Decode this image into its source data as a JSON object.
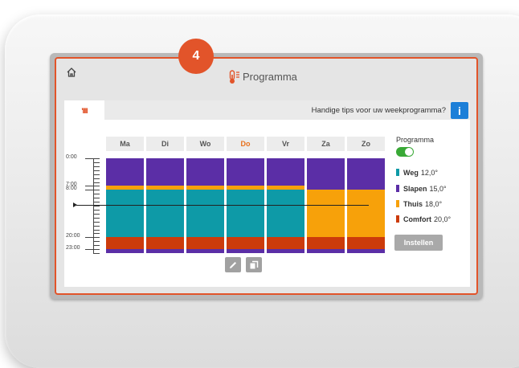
{
  "step_badge": "4",
  "header": {
    "title": "Programma"
  },
  "tabs": {
    "active_tab_label": "'IIII"
  },
  "tips": {
    "text": "Handige tips voor uw weekprogramma?",
    "info_label": "i"
  },
  "days": [
    {
      "label": "Ma",
      "today": false
    },
    {
      "label": "Di",
      "today": false
    },
    {
      "label": "Wo",
      "today": false
    },
    {
      "label": "Do",
      "today": true
    },
    {
      "label": "Vr",
      "today": false
    },
    {
      "label": "Za",
      "today": false
    },
    {
      "label": "Zo",
      "today": false
    }
  ],
  "time_labels": [
    "0:00",
    "7:00",
    "8:00",
    "20:00",
    "23:00"
  ],
  "schedule": {
    "weekday": [
      {
        "mode": "slapen",
        "from": 0,
        "to": 7
      },
      {
        "mode": "thuis",
        "from": 7,
        "to": 8
      },
      {
        "mode": "weg",
        "from": 8,
        "to": 20
      },
      {
        "mode": "comfort",
        "from": 20,
        "to": 23
      },
      {
        "mode": "slapen",
        "from": 23,
        "to": 24
      }
    ],
    "weekend": [
      {
        "mode": "slapen",
        "from": 0,
        "to": 8
      },
      {
        "mode": "thuis",
        "from": 8,
        "to": 20
      },
      {
        "mode": "comfort",
        "from": 20,
        "to": 23
      },
      {
        "mode": "slapen",
        "from": 23,
        "to": 24
      }
    ]
  },
  "programma": {
    "label": "Programma",
    "enabled": true
  },
  "legend": [
    {
      "key": "weg",
      "name": "Weg",
      "temp": "12,0°",
      "color": "#0e9aa7"
    },
    {
      "key": "slapen",
      "name": "Slapen",
      "temp": "15,0°",
      "color": "#5b2ea6"
    },
    {
      "key": "thuis",
      "name": "Thuis",
      "temp": "18,0°",
      "color": "#f7a10a"
    },
    {
      "key": "comfort",
      "name": "Comfort",
      "temp": "20,0°",
      "color": "#cc3b0b"
    }
  ],
  "buttons": {
    "instellen": "Instellen"
  },
  "colors": {
    "accent": "#e2542a",
    "info": "#1c7fd8",
    "toggle_on": "#39a936",
    "today": "#e8711d"
  },
  "icons": [
    "home-icon",
    "thermometer-icon",
    "radiator-icon",
    "info-icon",
    "edit-icon",
    "copy-icon"
  ]
}
